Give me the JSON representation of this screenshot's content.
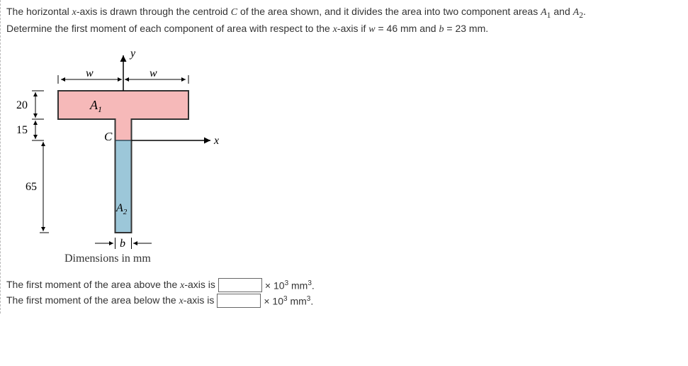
{
  "problem": {
    "line1a": "The horizontal ",
    "xaxis": "x",
    "line1b": "-axis is drawn through the centroid ",
    "C": "C",
    "line1c": " of the area shown, and it divides the area into two component areas ",
    "A1": "A",
    "A1sub": "1",
    "and": " and ",
    "A2": "A",
    "A2sub": "2",
    "period": ".",
    "line2a": "Determine the first moment of each component of area with respect to the ",
    "line2b": "-axis if ",
    "w": "w",
    "eqw": " = 46 mm and ",
    "b": "b",
    "eqb": " = 23 mm."
  },
  "figure": {
    "y": "y",
    "x": "x",
    "w1": "w",
    "w2": "w",
    "d20": "20",
    "d15": "15",
    "d65": "65",
    "A1": "A",
    "A1s": "1",
    "C": "C",
    "A2": "A",
    "A2s": "2",
    "b": "b",
    "caption": "Dimensions in mm"
  },
  "answers": {
    "label_above": "The first moment of the area above the ",
    "label_below": "The first moment of the area below the ",
    "axis_is": "-axis is",
    "unit_prefix": "× 10",
    "unit_exp": "3",
    "unit_mm": " mm",
    "unit_mmexp": "3",
    "unit_period": "."
  }
}
